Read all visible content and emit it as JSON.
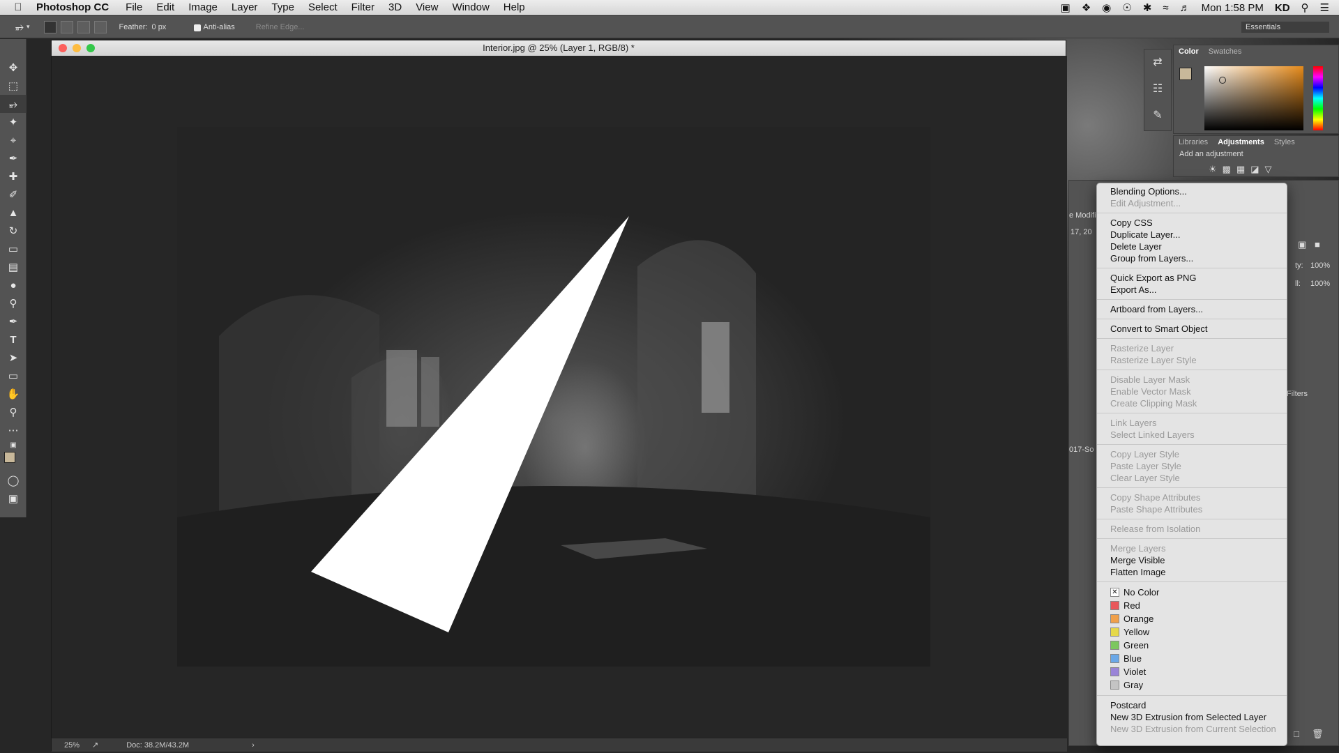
{
  "menubar": {
    "app_name": "Photoshop CC",
    "items": [
      "File",
      "Edit",
      "Image",
      "Layer",
      "Type",
      "Select",
      "Filter",
      "3D",
      "View",
      "Window",
      "Help"
    ],
    "clock": "Mon 1:58 PM",
    "user": "KD"
  },
  "options": {
    "feather_label": "Feather:",
    "feather_value": "0 px",
    "antialias_label": "Anti-alias",
    "refine_label": "Refine Edge...",
    "workspace": "Essentials"
  },
  "document": {
    "title": "Interior.jpg @ 25% (Layer 1, RGB/8) *",
    "zoom": "25%",
    "doc_size": "Doc: 38.2M/43.2M"
  },
  "panels": {
    "color_tabs": [
      "Color",
      "Swatches"
    ],
    "adj_tabs": [
      "Libraries",
      "Adjustments",
      "Styles"
    ],
    "add_adjustment": "Add an adjustment",
    "opacity_label": "ty:",
    "opacity_value": "100%",
    "fill_label": "ll:",
    "fill_value": "100%",
    "filters_label": "Filters",
    "frag_modified": "e Modifi",
    "frag_date": "17, 20",
    "frag_layer": "017-So"
  },
  "context_menu": {
    "groups": [
      [
        {
          "label": "Blending Options...",
          "enabled": true
        },
        {
          "label": "Edit Adjustment...",
          "enabled": false
        }
      ],
      [
        {
          "label": "Copy CSS",
          "enabled": true
        },
        {
          "label": "Duplicate Layer...",
          "enabled": true
        },
        {
          "label": "Delete Layer",
          "enabled": true
        },
        {
          "label": "Group from Layers...",
          "enabled": true
        }
      ],
      [
        {
          "label": "Quick Export as PNG",
          "enabled": true
        },
        {
          "label": "Export As...",
          "enabled": true
        }
      ],
      [
        {
          "label": "Artboard from Layers...",
          "enabled": true
        }
      ],
      [
        {
          "label": "Convert to Smart Object",
          "enabled": true
        }
      ],
      [
        {
          "label": "Rasterize Layer",
          "enabled": false
        },
        {
          "label": "Rasterize Layer Style",
          "enabled": false
        }
      ],
      [
        {
          "label": "Disable Layer Mask",
          "enabled": false
        },
        {
          "label": "Enable Vector Mask",
          "enabled": false
        },
        {
          "label": "Create Clipping Mask",
          "enabled": false
        }
      ],
      [
        {
          "label": "Link Layers",
          "enabled": false
        },
        {
          "label": "Select Linked Layers",
          "enabled": false
        }
      ],
      [
        {
          "label": "Copy Layer Style",
          "enabled": false
        },
        {
          "label": "Paste Layer Style",
          "enabled": false
        },
        {
          "label": "Clear Layer Style",
          "enabled": false
        }
      ],
      [
        {
          "label": "Copy Shape Attributes",
          "enabled": false
        },
        {
          "label": "Paste Shape Attributes",
          "enabled": false
        }
      ],
      [
        {
          "label": "Release from Isolation",
          "enabled": false
        }
      ],
      [
        {
          "label": "Merge Layers",
          "enabled": false
        },
        {
          "label": "Merge Visible",
          "enabled": true
        },
        {
          "label": "Flatten Image",
          "enabled": true
        }
      ]
    ],
    "colors": [
      {
        "label": "No Color",
        "color": "none"
      },
      {
        "label": "Red",
        "color": "#e8575a"
      },
      {
        "label": "Orange",
        "color": "#f0a04a"
      },
      {
        "label": "Yellow",
        "color": "#e6d94a"
      },
      {
        "label": "Green",
        "color": "#7cc75f"
      },
      {
        "label": "Blue",
        "color": "#6aa8e8"
      },
      {
        "label": "Violet",
        "color": "#9a84d8"
      },
      {
        "label": "Gray",
        "color": "#c4c4c4"
      }
    ],
    "extras": [
      {
        "label": "Postcard",
        "enabled": true
      },
      {
        "label": "New 3D Extrusion from Selected Layer",
        "enabled": true
      },
      {
        "label": "New 3D Extrusion from Current Selection",
        "enabled": false
      }
    ]
  }
}
